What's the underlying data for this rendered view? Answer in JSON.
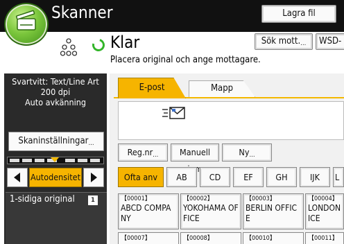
{
  "header": {
    "app_title": "Skanner",
    "store_file_button": "Lagra fil"
  },
  "status": {
    "state": "Klar",
    "hint": "Placera original och ange mottagare.",
    "search_dest_button": "Sök mott.",
    "wsd_button": "WSD-",
    "ready_color": "#33b52a"
  },
  "scan_panel": {
    "mode_line1": "Svartvitt: Text/Line Art",
    "mode_line2": "200 dpi",
    "mode_line3": "Auto avkänning",
    "settings_button": "Skaninställningar",
    "density_button": "Autodensitet",
    "original_label": "1-sidiga original"
  },
  "tabs": [
    {
      "label": "E-post",
      "selected": true
    },
    {
      "label": "Mapp",
      "selected": false
    }
  ],
  "actions": {
    "reg_no": "Reg.nr",
    "manual": "Manuell inm",
    "new": "Ny"
  },
  "index": [
    {
      "label": "Ofta anv",
      "selected": true
    },
    {
      "label": "AB",
      "selected": false
    },
    {
      "label": "CD",
      "selected": false
    },
    {
      "label": "EF",
      "selected": false
    },
    {
      "label": "GH",
      "selected": false
    },
    {
      "label": "IJK",
      "selected": false
    },
    {
      "label": "L",
      "selected": false
    }
  ],
  "destinations": [
    {
      "num": "【00001】",
      "name": "ABCD COMPANY"
    },
    {
      "num": "【00002】",
      "name": "YOKOHAMA OFFICE"
    },
    {
      "num": "【00003】",
      "name": "BERLIN OFFICE"
    },
    {
      "num": "【00004】",
      "name": "LONDON ICE"
    }
  ],
  "destinations_row2": [
    {
      "num": "【00007】"
    },
    {
      "num": "【00008】"
    },
    {
      "num": "【00010】"
    },
    {
      "num": "【00011】"
    }
  ],
  "colors": {
    "accent": "#f6b400",
    "title_bar": "#111111",
    "panel": "#2a2a2a"
  },
  "icons": [
    "scanner-app-icon",
    "status-dots-icon",
    "ready-ring-icon",
    "email-envelope-icon",
    "single-sided-original-icon"
  ]
}
